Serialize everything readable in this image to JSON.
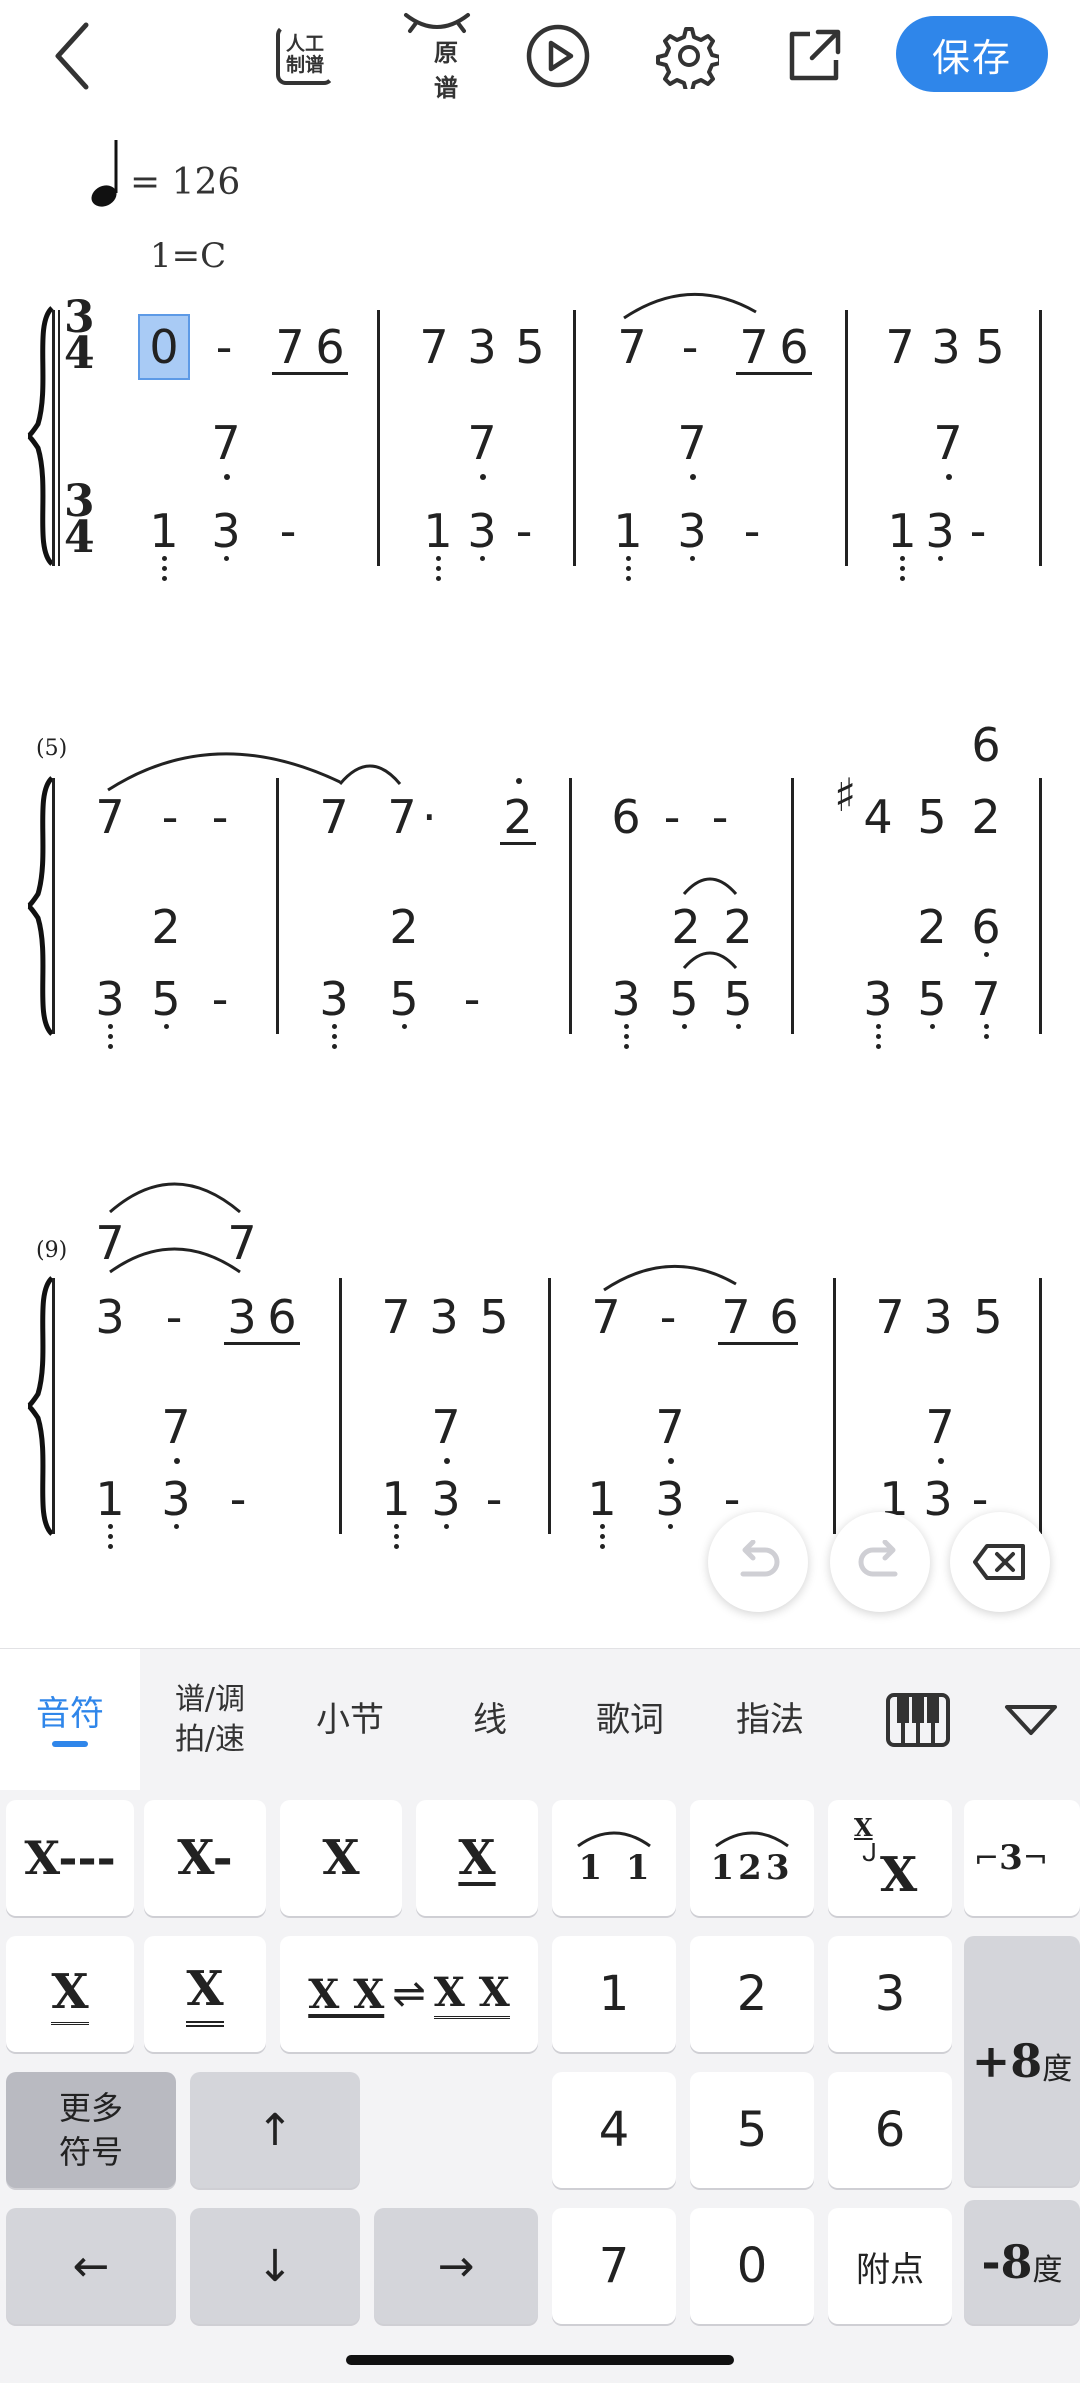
{
  "toolbar": {
    "manual_label_line1": "人工",
    "manual_label_line2": "制谱",
    "original_label": "原谱",
    "save_label": "保存"
  },
  "score": {
    "tempo": "= 126",
    "key": "1=C",
    "time_signature_top": "3",
    "time_signature_bottom": "4",
    "measure_numbers": [
      "(5)",
      "(9)"
    ],
    "sharp": "♯",
    "dash": "-",
    "dot_after": "·"
  },
  "tabs": {
    "notes": "音符",
    "score_key_line1": "谱/调",
    "score_key_line2": "拍/速",
    "measure": "小节",
    "line": "线",
    "lyrics": "歌词",
    "fingering": "指法"
  },
  "keyboard": {
    "whole": "X---",
    "half": "X-",
    "quarter": "X",
    "eighth": "X",
    "tie": "1  1",
    "slur": "123",
    "grace": "X",
    "triplet": "3",
    "sixteenth": "X",
    "thirtysecond": "X",
    "swap_left": "X X",
    "swap_arrow": "⇌",
    "swap_right": "X X",
    "n1": "1",
    "n2": "2",
    "n3": "3",
    "n4": "4",
    "n5": "5",
    "n6": "6",
    "n7": "7",
    "n0": "0",
    "octave_up": "+8",
    "octave_down": "-8",
    "octave_unit": "度",
    "more_line1": "更多",
    "more_line2": "符号",
    "dot": "附点",
    "up": "↑",
    "down": "↓",
    "left": "←",
    "right": "→"
  },
  "colors": {
    "accent": "#2f86ea",
    "selection": "#a9cbf5"
  }
}
